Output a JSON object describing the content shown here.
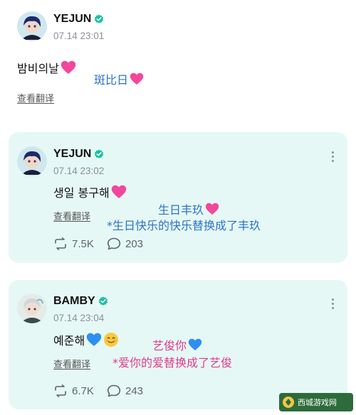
{
  "posts": [
    {
      "author": "YEJUN",
      "time": "07.14 23:01",
      "text": "밤비의날",
      "translate": "查看翻译",
      "annotation": "斑比日"
    },
    {
      "author": "YEJUN",
      "time": "07.14 23:02",
      "text": "생일 봉구해",
      "translate": "查看翻译",
      "annotation_line1": "生日丰玖",
      "annotation_line2": "*生日快乐的快乐替换成了丰玖",
      "reposts": "7.5K",
      "comments": "203"
    },
    {
      "author": "BAMBY",
      "time": "07.14 23:04",
      "text": "예준해",
      "translate": "查看翻译",
      "annotation_line1": "艺俊你",
      "annotation_line2": "*爱你的爱替换成了艺俊",
      "reposts": "6.7K",
      "comments": "243"
    }
  ],
  "colors": {
    "card_bg": "#e6f8f5",
    "verified": "#19c2a0",
    "annotation_blue": "#2a73c9",
    "annotation_pink": "#e23a8c"
  },
  "icons": [
    "verified-badge-icon",
    "pink-heart-icon",
    "blue-heart-icon",
    "smiling-face-icon",
    "more-options-icon",
    "repost-icon",
    "comment-icon"
  ],
  "watermark": {
    "text": "西城游戏网"
  }
}
